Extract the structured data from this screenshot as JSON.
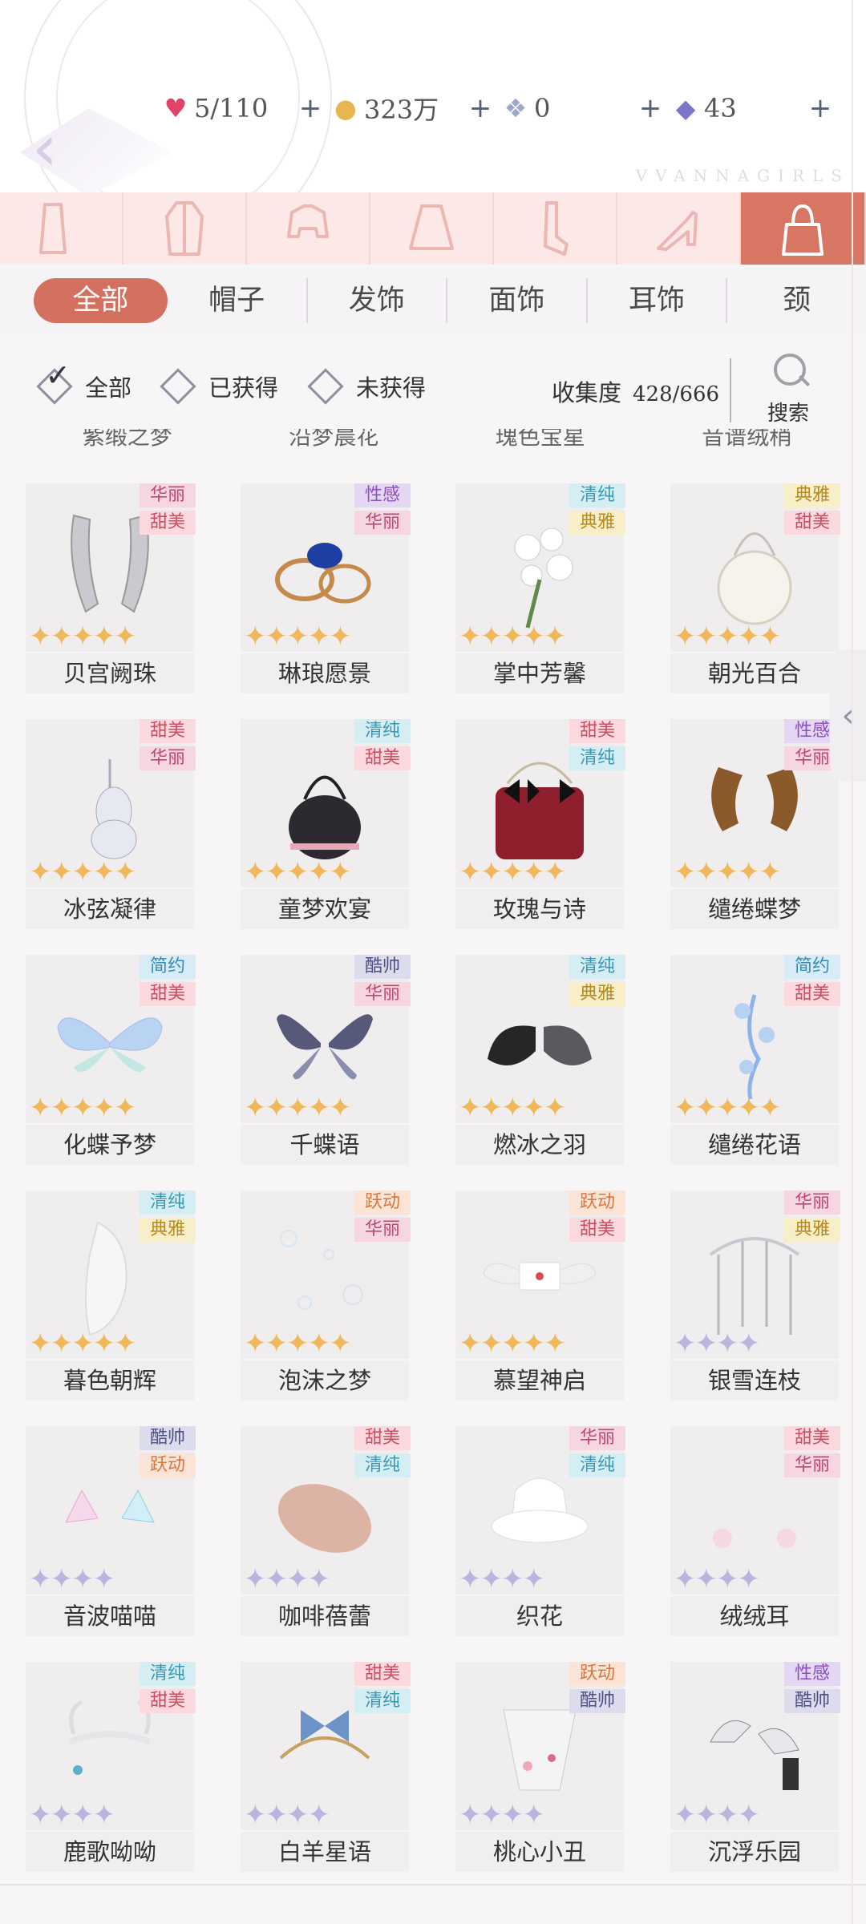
{
  "colors": {
    "accent": "#d4705f",
    "badge": {
      "华丽": {
        "bg": "#f6d6e0",
        "fg": "#c2456d"
      },
      "甜美": {
        "bg": "#fbd9de",
        "fg": "#d24a5f"
      },
      "性感": {
        "bg": "#e4d7f1",
        "fg": "#8b4fc4"
      },
      "清纯": {
        "bg": "#d5eef4",
        "fg": "#3a98b5"
      },
      "典雅": {
        "bg": "#f8efc8",
        "fg": "#b58a1e"
      },
      "简约": {
        "bg": "#d7ecf6",
        "fg": "#3a87b3"
      },
      "酷帅": {
        "bg": "#dcdcec",
        "fg": "#4e4f86"
      },
      "跃动": {
        "bg": "#fbe3d5",
        "fg": "#d77740"
      }
    },
    "star_gold": "#f1b85b",
    "star_purple": "#b8b6de"
  },
  "watermark": "VVANNAGIRLS",
  "currency": [
    {
      "icon": "heart-gem-icon",
      "glyph": "♥",
      "color": "#e0446a",
      "value": "5/110",
      "plus": "+"
    },
    {
      "icon": "gold-coin-icon",
      "glyph": "●",
      "color": "#e8b64f",
      "value": "323万",
      "plus": "+"
    },
    {
      "icon": "crystal-icon",
      "glyph": "❖",
      "color": "#9ba8c8",
      "value": "0",
      "plus": "+"
    },
    {
      "icon": "diamond-icon",
      "glyph": "◆",
      "color": "#7c76c8",
      "value": "43",
      "plus": "+"
    }
  ],
  "categories": [
    {
      "name": "category-dress"
    },
    {
      "name": "category-coat"
    },
    {
      "name": "category-top"
    },
    {
      "name": "category-skirt"
    },
    {
      "name": "category-socks"
    },
    {
      "name": "category-shoes"
    },
    {
      "name": "category-accessories",
      "active": true
    }
  ],
  "subtabs": [
    "全部",
    "帽子",
    "发饰",
    "面饰",
    "耳饰",
    "颈"
  ],
  "filters": {
    "all": "全部",
    "owned": "已获得",
    "not_owned": "未获得"
  },
  "progress": {
    "label": "收集度",
    "value": "428/666"
  },
  "search_label": "搜索",
  "prev_row": [
    "紫缎之梦",
    "沿梦晨花",
    "瑰色宝星",
    "音谱绒稍"
  ],
  "items": [
    {
      "name": "贝宫阙珠",
      "tags": [
        "华丽",
        "甜美"
      ],
      "stars": 5,
      "star": "gold",
      "icon": "gloves-icon"
    },
    {
      "name": "琳琅愿景",
      "tags": [
        "性感",
        "华丽"
      ],
      "stars": 5,
      "star": "gold",
      "icon": "rings-icon"
    },
    {
      "name": "掌中芳馨",
      "tags": [
        "清纯",
        "典雅"
      ],
      "stars": 5,
      "star": "gold",
      "icon": "bouquet-icon"
    },
    {
      "name": "朝光百合",
      "tags": [
        "典雅",
        "甜美"
      ],
      "stars": 5,
      "star": "gold",
      "icon": "round-bag-icon"
    },
    {
      "name": "冰弦凝律",
      "tags": [
        "甜美",
        "华丽"
      ],
      "stars": 5,
      "star": "gold",
      "icon": "violin-icon"
    },
    {
      "name": "童梦欢宴",
      "tags": [
        "清纯",
        "甜美"
      ],
      "stars": 5,
      "star": "gold",
      "icon": "black-bag-icon"
    },
    {
      "name": "玫瑰与诗",
      "tags": [
        "甜美",
        "清纯"
      ],
      "stars": 5,
      "star": "gold",
      "icon": "red-bag-icon"
    },
    {
      "name": "缱绻蝶梦",
      "tags": [
        "性感",
        "华丽"
      ],
      "stars": 5,
      "star": "gold",
      "icon": "hair-ornament-icon"
    },
    {
      "name": "化蝶予梦",
      "tags": [
        "简约",
        "甜美"
      ],
      "stars": 5,
      "star": "gold",
      "icon": "butterfly-wings-icon"
    },
    {
      "name": "千蝶语",
      "tags": [
        "酷帅",
        "华丽"
      ],
      "stars": 5,
      "star": "gold",
      "icon": "dark-wings-icon"
    },
    {
      "name": "燃冰之羽",
      "tags": [
        "清纯",
        "典雅"
      ],
      "stars": 5,
      "star": "gold",
      "icon": "feather-wings-icon"
    },
    {
      "name": "缱绻花语",
      "tags": [
        "简约",
        "甜美"
      ],
      "stars": 5,
      "star": "gold",
      "icon": "flower-vine-icon"
    },
    {
      "name": "暮色朝辉",
      "tags": [
        "清纯",
        "典雅"
      ],
      "stars": 5,
      "star": "gold",
      "icon": "white-glove-icon"
    },
    {
      "name": "泡沫之梦",
      "tags": [
        "跃动",
        "华丽"
      ],
      "stars": 5,
      "star": "gold",
      "icon": "bubbles-icon"
    },
    {
      "name": "慕望神启",
      "tags": [
        "跃动",
        "甜美"
      ],
      "stars": 5,
      "star": "gold",
      "icon": "winged-letter-icon"
    },
    {
      "name": "银雪连枝",
      "tags": [
        "华丽",
        "典雅"
      ],
      "stars": 4,
      "star": "purple",
      "icon": "silver-branch-icon"
    },
    {
      "name": "音波喵喵",
      "tags": [
        "酷帅",
        "跃动"
      ],
      "stars": 4,
      "star": "purple",
      "icon": "cat-ears-icon"
    },
    {
      "name": "咖啡蓓蕾",
      "tags": [
        "甜美",
        "清纯"
      ],
      "stars": 4,
      "star": "purple",
      "icon": "beret-icon"
    },
    {
      "name": "织花",
      "tags": [
        "华丽",
        "清纯"
      ],
      "stars": 4,
      "star": "purple",
      "icon": "bucket-hat-icon"
    },
    {
      "name": "绒绒耳",
      "tags": [
        "甜美",
        "华丽"
      ],
      "stars": 4,
      "star": "purple",
      "icon": "fluffy-ears-icon"
    },
    {
      "name": "鹿歌呦呦",
      "tags": [
        "清纯",
        "甜美"
      ],
      "stars": 4,
      "star": "purple",
      "icon": "antler-icon"
    },
    {
      "name": "白羊星语",
      "tags": [
        "甜美",
        "清纯"
      ],
      "stars": 4,
      "star": "purple",
      "icon": "bow-headband-icon"
    },
    {
      "name": "桃心小丑",
      "tags": [
        "跃动",
        "酷帅"
      ],
      "stars": 4,
      "star": "purple",
      "icon": "clown-hat-icon"
    },
    {
      "name": "沉浮乐园",
      "tags": [
        "性感",
        "酷帅"
      ],
      "stars": 4,
      "star": "purple",
      "icon": "horns-icon"
    }
  ],
  "side_tab": "‹"
}
